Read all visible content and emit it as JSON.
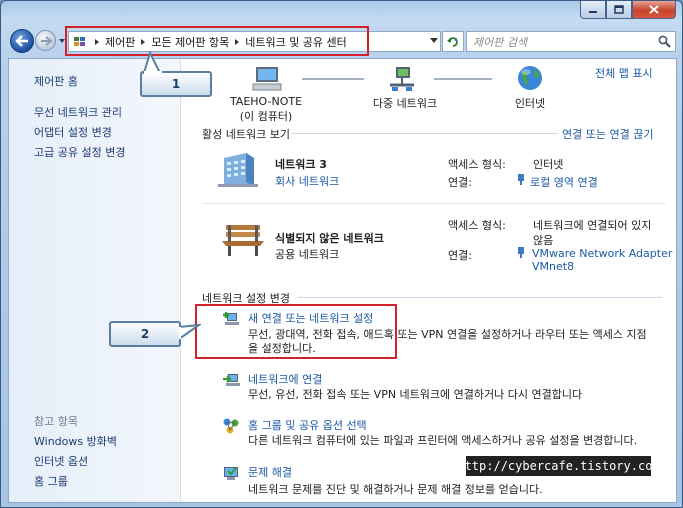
{
  "window": {
    "buttons": {
      "minimize": "minimize-icon",
      "maximize": "maximize-icon",
      "close": "close-icon"
    }
  },
  "address": {
    "segments": [
      "제어판",
      "모든 제어판 항목",
      "네트워크 및 공유 센터"
    ]
  },
  "search": {
    "placeholder": "제어판 검색"
  },
  "sidebar": {
    "home": "제어판 홈",
    "items": [
      "무선 네트워크 관리",
      "어댑터 설정 변경",
      "고급 공유 설정 변경"
    ],
    "see_also_heading": "참고 항목",
    "see_also": [
      "Windows 방화벽",
      "인터넷 옵션",
      "홈 그룹"
    ]
  },
  "map": {
    "view_full_map": "전체 맵 표시",
    "nodes": [
      {
        "label": "TAEHO-NOTE",
        "sublabel": "(이 컴퓨터)"
      },
      {
        "label": "다중 네트워크"
      },
      {
        "label": "인터넷"
      }
    ]
  },
  "active": {
    "title": "활성 네트워크 보기",
    "connect_link": "연결 또는 연결 끊기",
    "networks": [
      {
        "name": "네트워크  3",
        "type": "회사 네트워크",
        "access_label": "액세스 형식:",
        "access_value": "인터넷",
        "conn_label": "연결:",
        "conn_value": "로컬 영역 연결"
      },
      {
        "name": "식별되지 않은 네트워크",
        "type": "공용 네트워크",
        "access_label": "액세스 형식:",
        "access_value_1": "네트워크에 연결되어 있지",
        "access_value_2": "않음",
        "conn_label": "연결:",
        "conn_value_1": "VMware Network Adapter",
        "conn_value_2": "VMnet8"
      }
    ]
  },
  "settings": {
    "title": "네트워크 설정 변경",
    "tasks": [
      {
        "title": "새 연결 또는 네트워크 설정",
        "desc_1": "무선, 광대역, 전화 접속, 애드혹 또는 VPN 연결을 설정하거나 라우터 또는 액세스 지점",
        "desc_2": "을 설정합니다."
      },
      {
        "title": "네트워크에 연결",
        "desc_1": "무선, 유선, 전화 접속 또는 VPN 네트워크에 연결하거나 다시 연결합니다"
      },
      {
        "title": "홈 그룹 및 공유 옵션 선택",
        "desc_1": "다른 네트워크 컴퓨터에 있는 파일과 프린터에 액세스하거나 공유 설정을 변경합니다."
      },
      {
        "title": "문제 해결",
        "desc_1": "네트워크 문제를 진단 및 해결하거나 문제 해결 정보를 얻습니다."
      }
    ]
  },
  "callouts": [
    "1",
    "2"
  ],
  "watermark": "http://cybercafe.tistory.com"
}
